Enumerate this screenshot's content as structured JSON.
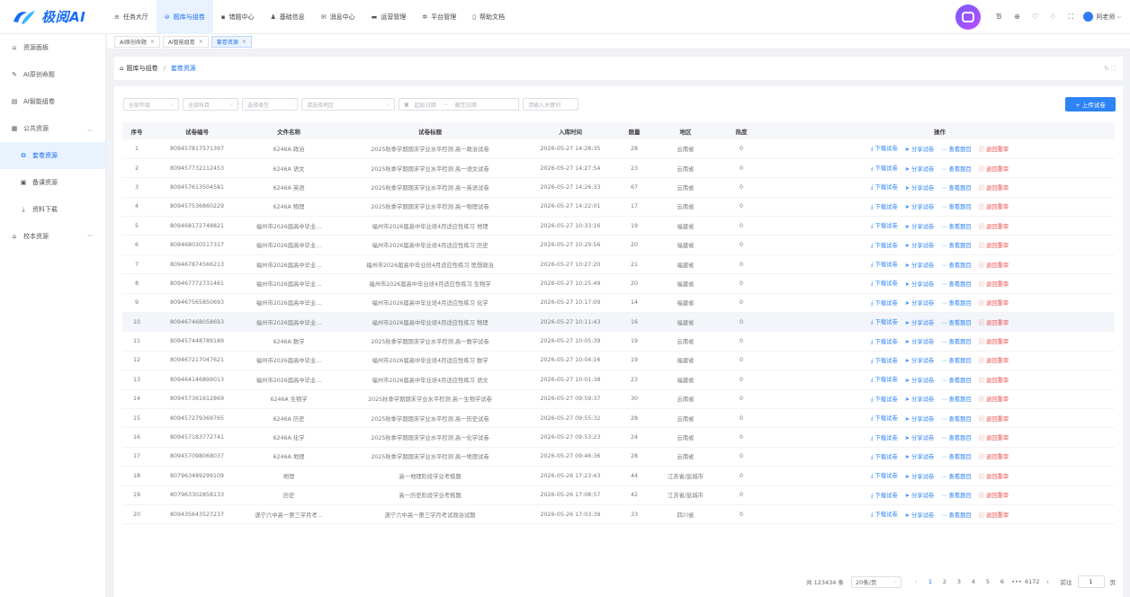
{
  "brand": {
    "name": "极阅AI",
    "accent": "#1a6ef5"
  },
  "nav": [
    {
      "label": "任务大厅",
      "icon": "menu-icon"
    },
    {
      "label": "题库与组卷",
      "icon": "stack-icon",
      "active": true
    },
    {
      "label": "错题中心",
      "icon": "folder-icon"
    },
    {
      "label": "基础信息",
      "icon": "person-icon"
    },
    {
      "label": "消息中心",
      "icon": "mail-icon"
    },
    {
      "label": "运营管理",
      "icon": "chart-icon"
    },
    {
      "label": "平台管理",
      "icon": "gear-icon"
    },
    {
      "label": "帮助文档",
      "icon": "doc-icon"
    }
  ],
  "user": {
    "name": "阿老师"
  },
  "sidebar": [
    {
      "label": "资源面板",
      "icon": "home-icon"
    },
    {
      "label": "AI原创命题",
      "icon": "pen-icon"
    },
    {
      "label": "AI智能组卷",
      "icon": "paper-icon"
    },
    {
      "label": "公共资源",
      "icon": "grid-icon",
      "expanded": true
    },
    {
      "label": "套卷资源",
      "icon": "copy-icon",
      "sub": true,
      "selected": true
    },
    {
      "label": "备课资源",
      "icon": "book-icon",
      "sub": true
    },
    {
      "label": "资料下载",
      "icon": "download-icon",
      "sub": true
    },
    {
      "label": "校本资源",
      "icon": "school-icon",
      "collapsed": true
    }
  ],
  "tabs": [
    {
      "label": "AI原创命题",
      "active": false
    },
    {
      "label": "AI智能组卷",
      "active": false
    },
    {
      "label": "套卷资源",
      "active": true
    }
  ],
  "breadcrumb": {
    "root": "题库与组卷",
    "sep": "/",
    "current": "套卷资源"
  },
  "filters": {
    "grade": "全部年级",
    "subject": "全部科目",
    "type": "选择类型",
    "region": "请选择地区",
    "start": "起始日期",
    "range_sep": "~",
    "end": "截至日期",
    "keyword": "请输入关键词"
  },
  "upload_label": "+ 上传试卷",
  "columns": [
    "序号",
    "试卷编号",
    "文件名称",
    "试卷标题",
    "入库时间",
    "题量",
    "地区",
    "热度",
    "操作"
  ],
  "actions": {
    "download": "下载试卷",
    "share": "分享试卷",
    "view": "查看题目",
    "reject": "退回重审"
  },
  "rows": [
    [
      "1",
      "809457817571397",
      "6246A 政治",
      "2025秋季学期期末学业水平检测 高一政治试卷",
      "2026-05-27 14:28:35",
      "28",
      "云南省",
      "0"
    ],
    [
      "2",
      "809457732112453",
      "6246A 语文",
      "2025秋季学期期末学业水平检测 高一语文试卷",
      "2026-05-27 14:27:54",
      "23",
      "云南省",
      "0"
    ],
    [
      "3",
      "809457613504581",
      "6246A 英语",
      "2025秋季学期期末学业水平检测 高一英语试卷",
      "2026-05-27 14:26:33",
      "67",
      "云南省",
      "0"
    ],
    [
      "4",
      "809457536860229",
      "6246A 物理",
      "2025秋季学期期末学业水平检测 高一物理试卷",
      "2026-05-27 14:22:01",
      "17",
      "云南省",
      "0"
    ],
    [
      "5",
      "809468172748821",
      "福州市2026届高中毕业...",
      "福州市2026届高中毕业班4月适应性练习 地理",
      "2026-05-27 10:33:16",
      "19",
      "福建省",
      "0"
    ],
    [
      "6",
      "809468030517317",
      "福州市2026届高中毕业...",
      "福州市2026届高中毕业班4月适应性练习 历史",
      "2026-05-27 10:29:56",
      "20",
      "福建省",
      "0"
    ],
    [
      "7",
      "809467874566213",
      "福州市2026届高中毕业...",
      "福州市2026届高中毕业班4月适应性练习 思想政治",
      "2026-05-27 10:27:20",
      "21",
      "福建省",
      "0"
    ],
    [
      "8",
      "809467772731461",
      "福州市2026届高中毕业...",
      "福州市2026届高中毕业班4月适应性练习 生物学",
      "2026-05-27 10:25:49",
      "20",
      "福建省",
      "0"
    ],
    [
      "9",
      "809467565850693",
      "福州市2026届高中毕业...",
      "福州市2026届高中毕业班4月适应性练习 化学",
      "2026-05-27 10:17:09",
      "14",
      "福建省",
      "0"
    ],
    [
      "10",
      "809467468058693",
      "福州市2026届高中毕业...",
      "福州市2026届高中毕业班4月适应性练习 物理",
      "2026-05-27 10:11:43",
      "16",
      "福建省",
      "0"
    ],
    [
      "11",
      "809457448789189",
      "6246A 数学",
      "2025秋季学期期末学业水平检测 高一数学试卷",
      "2026-05-27 10:05:39",
      "19",
      "云南省",
      "0"
    ],
    [
      "12",
      "809467217047621",
      "福州市2026届高中毕业...",
      "福州市2026届高中毕业班4月适应性练习 数学",
      "2026-05-27 10:04:16",
      "19",
      "福建省",
      "0"
    ],
    [
      "13",
      "809464146899013",
      "福州市2026届高中毕业...",
      "福州市2026届高中毕业班4月适应性练习 语文",
      "2026-05-27 10:01:38",
      "23",
      "福建省",
      "0"
    ],
    [
      "14",
      "809457361612869",
      "6246A 生物学",
      "2025秋季学期期末学业水平检测 高一生物学试卷",
      "2026-05-27 09:59:37",
      "30",
      "云南省",
      "0"
    ],
    [
      "15",
      "809457279369765",
      "6246A 历史",
      "2025秋季学期期末学业水平检测 高一历史试卷",
      "2026-05-27 09:55:32",
      "28",
      "云南省",
      "0"
    ],
    [
      "16",
      "809457183772741",
      "6246A 化学",
      "2025秋季学期期末学业水平检测 高一化学试卷",
      "2026-05-27 09:53:23",
      "24",
      "云南省",
      "0"
    ],
    [
      "17",
      "809457098068037",
      "6246A 地理",
      "2025秋季学期期末学业水平检测 高一地理试卷",
      "2026-05-27 09:46:36",
      "28",
      "云南省",
      "0"
    ],
    [
      "18",
      "807963489299109",
      "地理",
      "高一地理阶段学业考核题",
      "2026-05-26 17:23:43",
      "44",
      "江苏省/盐城市",
      "0"
    ],
    [
      "19",
      "807963302858133",
      "历史",
      "高一历史阶段学业考核题",
      "2026-05-26 17:08:57",
      "42",
      "江苏省/盐城市",
      "0"
    ],
    [
      "20",
      "809435643527237",
      "遂宁六中高一第三学月考...",
      "遂宁六中高一第三学月考试政治试题",
      "2026-05-26 17:03:39",
      "33",
      "四川省",
      "0"
    ]
  ],
  "highlight_row": "10",
  "pager": {
    "total": "共 123434 条",
    "page_size": "20条/页",
    "prev": "‹",
    "pages": [
      "1",
      "2",
      "3",
      "4",
      "5",
      "6"
    ],
    "more": "•••",
    "last": "6172",
    "next": "›",
    "goto": "前往",
    "goto_value": "1",
    "page_unit": "页"
  }
}
